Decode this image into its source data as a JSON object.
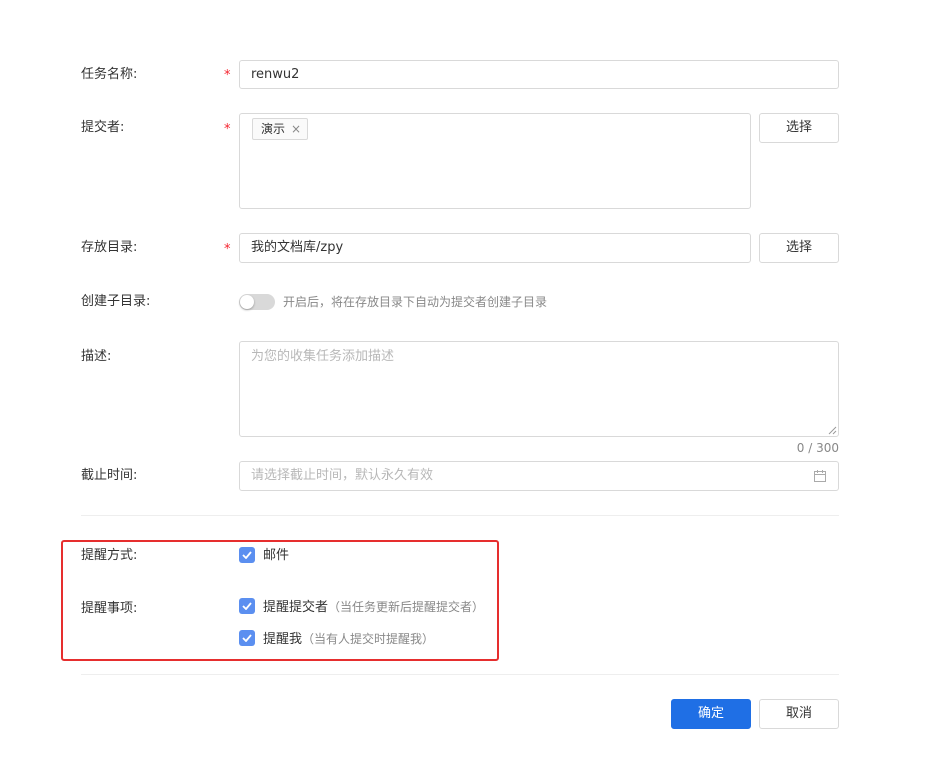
{
  "form": {
    "task_name": {
      "label": "任务名称:",
      "required_mark": "*",
      "value": "renwu2"
    },
    "submitter": {
      "label": "提交者:",
      "required_mark": "*",
      "tags": [
        {
          "text": "演示",
          "remove": "×"
        }
      ],
      "select_label": "选择"
    },
    "storage_dir": {
      "label": "存放目录:",
      "required_mark": "*",
      "value": "我的文档库/zpy",
      "select_label": "选择"
    },
    "create_subdir": {
      "label": "创建子目录:",
      "enabled": false,
      "hint": "开启后，将在存放目录下自动为提交者创建子目录"
    },
    "description": {
      "label": "描述:",
      "placeholder": "为您的收集任务添加描述",
      "counter": "0 / 300"
    },
    "deadline": {
      "label": "截止时间:",
      "placeholder": "请选择截止时间，默认永久有效",
      "icon": "calendar-icon"
    },
    "remind_method": {
      "label": "提醒方式:",
      "options": [
        {
          "text": "邮件",
          "checked": true
        }
      ]
    },
    "remind_items": {
      "label": "提醒事项:",
      "options": [
        {
          "text": "提醒提交者",
          "sub": "（当任务更新后提醒提交者）",
          "checked": true
        },
        {
          "text": "提醒我",
          "sub": "（当有人提交时提醒我）",
          "checked": true
        }
      ]
    }
  },
  "footer": {
    "confirm_label": "确定",
    "cancel_label": "取消"
  },
  "colors": {
    "primary": "#1f6fe5",
    "checkbox": "#5b8ff0",
    "required": "#f5222d",
    "highlight": "#e62e2e"
  }
}
